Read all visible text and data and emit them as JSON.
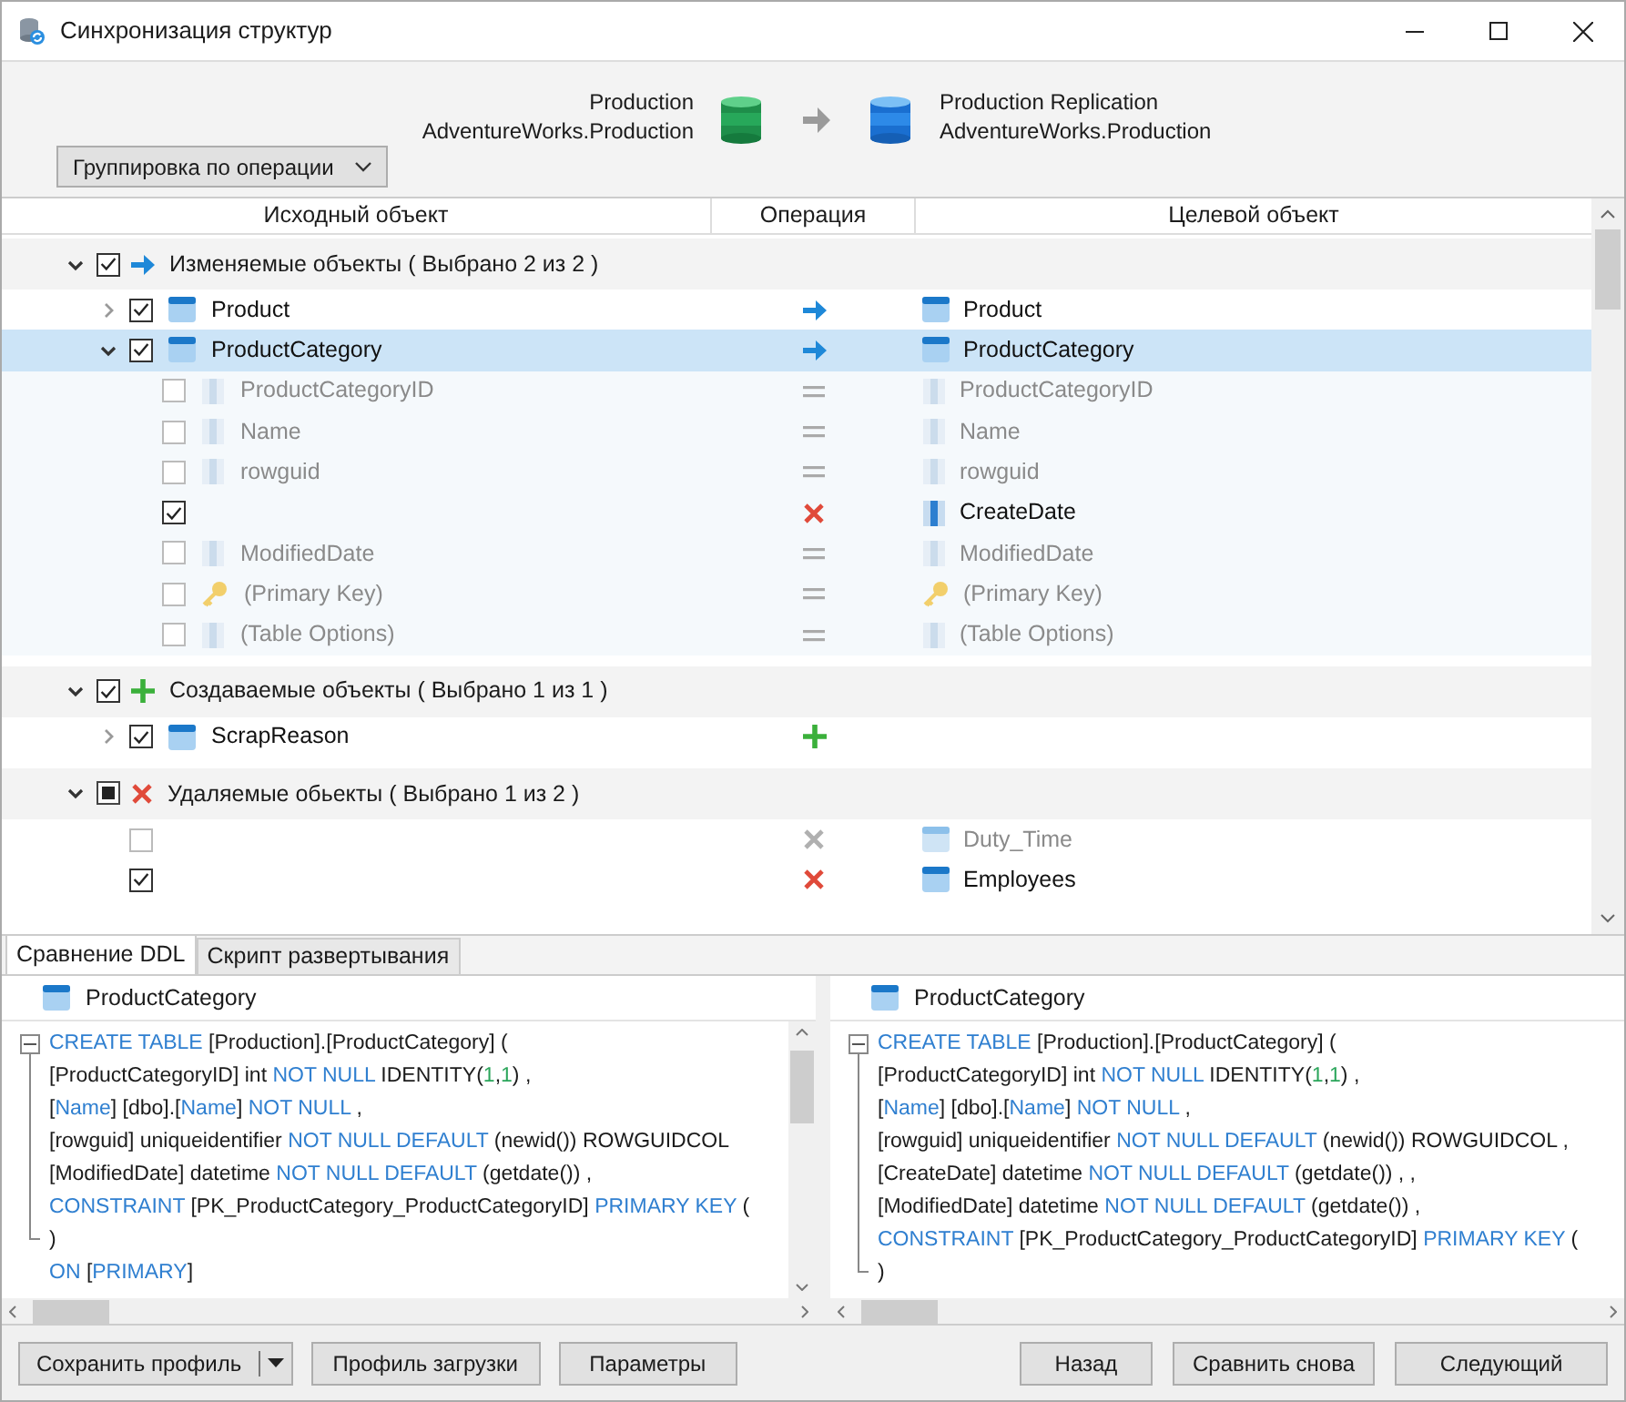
{
  "window": {
    "title": "Синхронизация структур"
  },
  "header": {
    "source": {
      "server": "Production",
      "database": "AdventureWorks.Production"
    },
    "target": {
      "server": "Production Replication",
      "database": "AdventureWorks.Production"
    },
    "grouping_button": "Группировка по операции"
  },
  "tree": {
    "columns": [
      "Исходный объект",
      "Операция",
      "Целевой объект"
    ],
    "groups": [
      {
        "label": "Изменяемые объекты ( Выбрано 2 из 2 )",
        "kind": "update",
        "expanded": true,
        "checked": true,
        "indeterminate": false,
        "items": [
          {
            "kind": "table",
            "source": "Product",
            "target": "Product",
            "operation": {
              "kind": "update"
            },
            "checked": true,
            "expanded": false,
            "dim": false,
            "selected": false
          },
          {
            "kind": "table",
            "source": "ProductCategory",
            "target": "ProductCategory",
            "operation": {
              "kind": "update"
            },
            "checked": true,
            "expanded": true,
            "dim": false,
            "selected": true,
            "children": [
              {
                "kind": "column",
                "source": "ProductCategoryID",
                "target": "ProductCategoryID",
                "operation": {
                  "kind": "equal"
                },
                "checked": false,
                "dim": true,
                "selected": false
              },
              {
                "kind": "column",
                "source": "Name",
                "target": "Name",
                "operation": {
                  "kind": "equal"
                },
                "checked": false,
                "dim": true,
                "selected": false
              },
              {
                "kind": "column",
                "source": "rowguid",
                "target": "rowguid",
                "operation": {
                  "kind": "equal"
                },
                "checked": false,
                "dim": true,
                "selected": false
              },
              {
                "kind": "column",
                "target": "CreateDate",
                "operation": {
                  "kind": "delete"
                },
                "checked": true,
                "dim": false,
                "selected": false
              },
              {
                "kind": "column",
                "source": "ModifiedDate",
                "target": "ModifiedDate",
                "operation": {
                  "kind": "equal"
                },
                "checked": false,
                "dim": true,
                "selected": false
              },
              {
                "kind": "key",
                "source": "(Primary Key)",
                "target": "(Primary Key)",
                "operation": {
                  "kind": "equal"
                },
                "checked": false,
                "dim": true,
                "selected": false
              },
              {
                "kind": "options",
                "source": "(Table Options)",
                "target": "(Table Options)",
                "operation": {
                  "kind": "equal"
                },
                "checked": false,
                "dim": true,
                "selected": false
              }
            ]
          }
        ]
      },
      {
        "label": "Создаваемые объекты ( Выбрано 1 из 1 )",
        "kind": "create",
        "expanded": true,
        "checked": true,
        "indeterminate": false,
        "items": [
          {
            "kind": "table",
            "source": "ScrapReason",
            "operation": {
              "kind": "create"
            },
            "checked": true,
            "expanded": false,
            "dim": false,
            "selected": false
          }
        ]
      },
      {
        "label": "Удаляемые обьекты ( Выбрано 1 из 2 )",
        "kind": "delete",
        "expanded": true,
        "checked": false,
        "indeterminate": true,
        "items": [
          {
            "kind": "table",
            "target": "Duty_Time",
            "operation": {
              "kind": "delete"
            },
            "checked": false,
            "dim": true,
            "selected": false
          },
          {
            "kind": "table",
            "target": "Employees",
            "operation": {
              "kind": "delete"
            },
            "checked": true,
            "dim": false,
            "selected": false
          }
        ]
      }
    ]
  },
  "ddl": {
    "tabs": [
      {
        "label": "Сравнение DDL",
        "selected": true
      },
      {
        "label": "Скрипт развертывания",
        "selected": false
      }
    ],
    "panes": [
      {
        "object": "ProductCategory",
        "lines": [
          {
            "kind": "fold_start",
            "tokens": [
              {
                "text": "CREATE TABLE",
                "kind": "keyword"
              },
              {
                "text": " [Production].[ProductCategory] (",
                "kind": "plain"
              }
            ]
          },
          {
            "tokens": [
              {
                "text": "[ProductCategoryID] int ",
                "kind": "plain"
              },
              {
                "text": "NOT NULL",
                "kind": "keyword"
              },
              {
                "text": " IDENTITY(",
                "kind": "plain"
              },
              {
                "text": "1",
                "kind": "number"
              },
              {
                "text": ",",
                "kind": "plain"
              },
              {
                "text": "1",
                "kind": "number"
              },
              {
                "text": ") ,",
                "kind": "plain"
              }
            ]
          },
          {
            "tokens": [
              {
                "text": "[",
                "kind": "plain"
              },
              {
                "text": "Name",
                "kind": "keyword"
              },
              {
                "text": "] [dbo].[",
                "kind": "plain"
              },
              {
                "text": "Name",
                "kind": "keyword"
              },
              {
                "text": "] ",
                "kind": "plain"
              },
              {
                "text": "NOT NULL",
                "kind": "keyword"
              },
              {
                "text": " ,",
                "kind": "plain"
              }
            ]
          },
          {
            "tokens": [
              {
                "text": "[rowguid] uniqueidentifier ",
                "kind": "plain"
              },
              {
                "text": "NOT NULL DEFAULT",
                "kind": "keyword"
              },
              {
                "text": " (newid()) ROWGUIDCOL",
                "kind": "plain"
              }
            ]
          },
          {
            "tokens": [
              {
                "text": "[ModifiedDate] datetime ",
                "kind": "plain"
              },
              {
                "text": "NOT NULL DEFAULT",
                "kind": "keyword"
              },
              {
                "text": " (getdate()) ,",
                "kind": "plain"
              }
            ]
          },
          {
            "tokens": [
              {
                "text": "CONSTRAINT",
                "kind": "keyword"
              },
              {
                "text": " [PK_ProductCategory_ProductCategoryID] ",
                "kind": "plain"
              },
              {
                "text": "PRIMARY KEY",
                "kind": "keyword"
              },
              {
                "text": " (",
                "kind": "plain"
              }
            ]
          },
          {
            "kind": "fold_end",
            "tokens": [
              {
                "text": ")",
                "kind": "plain"
              }
            ]
          },
          {
            "tokens": [
              {
                "text": "ON",
                "kind": "keyword"
              },
              {
                "text": " [",
                "kind": "plain"
              },
              {
                "text": "PRIMARY",
                "kind": "keyword"
              },
              {
                "text": "]",
                "kind": "plain"
              }
            ]
          }
        ]
      },
      {
        "object": "ProductCategory",
        "lines": [
          {
            "kind": "fold_start",
            "tokens": [
              {
                "text": "CREATE TABLE",
                "kind": "keyword"
              },
              {
                "text": " [Production].[ProductCategory] (",
                "kind": "plain"
              }
            ]
          },
          {
            "tokens": [
              {
                "text": "[ProductCategoryID] int ",
                "kind": "plain"
              },
              {
                "text": "NOT NULL",
                "kind": "keyword"
              },
              {
                "text": " IDENTITY(",
                "kind": "plain"
              },
              {
                "text": "1",
                "kind": "number"
              },
              {
                "text": ",",
                "kind": "plain"
              },
              {
                "text": "1",
                "kind": "number"
              },
              {
                "text": ") ,",
                "kind": "plain"
              }
            ]
          },
          {
            "tokens": [
              {
                "text": "[",
                "kind": "plain"
              },
              {
                "text": "Name",
                "kind": "keyword"
              },
              {
                "text": "] [dbo].[",
                "kind": "plain"
              },
              {
                "text": "Name",
                "kind": "keyword"
              },
              {
                "text": "] ",
                "kind": "plain"
              },
              {
                "text": "NOT NULL",
                "kind": "keyword"
              },
              {
                "text": " ,",
                "kind": "plain"
              }
            ]
          },
          {
            "tokens": [
              {
                "text": "[rowguid] uniqueidentifier ",
                "kind": "plain"
              },
              {
                "text": "NOT NULL DEFAULT",
                "kind": "keyword"
              },
              {
                "text": " (newid()) ROWGUIDCOL ,",
                "kind": "plain"
              }
            ]
          },
          {
            "tokens": [
              {
                "text": "[CreateDate] datetime ",
                "kind": "plain"
              },
              {
                "text": "NOT NULL DEFAULT",
                "kind": "keyword"
              },
              {
                "text": " (getdate()) , ,",
                "kind": "plain"
              }
            ]
          },
          {
            "tokens": [
              {
                "text": "[ModifiedDate] datetime ",
                "kind": "plain"
              },
              {
                "text": "NOT NULL DEFAULT",
                "kind": "keyword"
              },
              {
                "text": " (getdate()) ,",
                "kind": "plain"
              }
            ]
          },
          {
            "tokens": [
              {
                "text": "CONSTRAINT",
                "kind": "keyword"
              },
              {
                "text": " [PK_ProductCategory_ProductCategoryID] ",
                "kind": "plain"
              },
              {
                "text": "PRIMARY KEY",
                "kind": "keyword"
              },
              {
                "text": " (",
                "kind": "plain"
              }
            ]
          },
          {
            "kind": "fold_end",
            "tokens": [
              {
                "text": ")",
                "kind": "plain"
              }
            ]
          }
        ]
      }
    ]
  },
  "buttons_left": [
    {
      "label": "Сохранить профиль",
      "kind": "split"
    },
    {
      "label": "Профиль загрузки",
      "kind": "plain"
    },
    {
      "label": "Параметры",
      "kind": "plain"
    }
  ],
  "buttons_right": [
    {
      "label": "Назад",
      "kind": "plain"
    },
    {
      "label": "Сравнить снова",
      "kind": "plain"
    },
    {
      "label": "Следующий",
      "kind": "plain"
    }
  ]
}
